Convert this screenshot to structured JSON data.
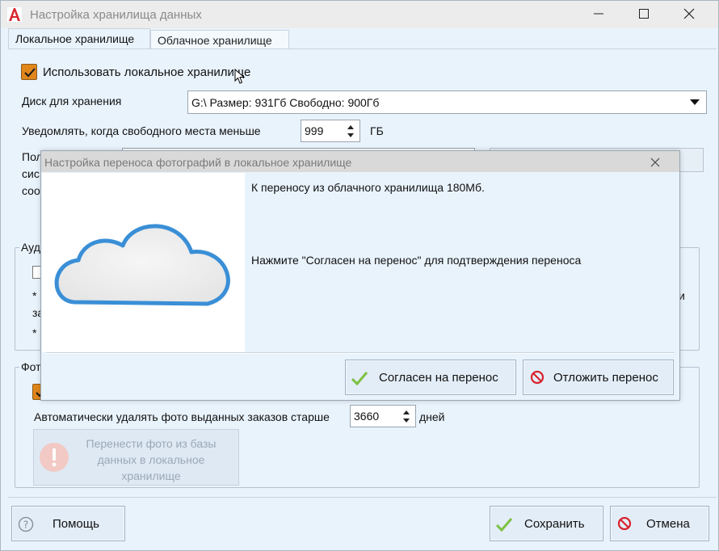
{
  "window": {
    "title": "Настройка хранилища данных"
  },
  "tabs": [
    {
      "label": "Локальное хранилище"
    },
    {
      "label": "Облачное хранилище"
    }
  ],
  "local": {
    "use_local_label": "Использовать локальное хранилище",
    "disk_label": "Диск для хранения",
    "disk_value": "G:\\ Размер: 931Гб Свободно: 900Гб",
    "notify_label": "Уведомлять, когда свободного места меньше",
    "notify_value": "999",
    "notify_unit": "ГБ",
    "partial_path_label_1": "Пол",
    "partial_path_label_2": "сис",
    "partial_path_label_3": "соо",
    "group_audio_title": "Ауд",
    "star1": "*",
    "partial_za": "за",
    "star2": "*",
    "partial_right": "и",
    "group_photo_title": "Фот",
    "auto_delete_label": "Автоматически удалять фото выданных заказов старше",
    "auto_delete_value": "3660",
    "auto_delete_unit": "дней",
    "transfer_button": "Перенести фото из базы данных в локальное хранилище"
  },
  "footer": {
    "help": "Помощь",
    "save": "Сохранить",
    "cancel": "Отмена"
  },
  "dialog": {
    "title": "Настройка переноса фотографий в локальное хранилище",
    "transfer_info": "К переносу из облачного хранилища  180Мб.",
    "instruction": "Нажмите \"Согласен на перенос\" для подтверждения переноса",
    "agree": "Согласен на перенос",
    "postpone": "Отложить перенос"
  },
  "colors": {
    "accent_orange": "#e0861a",
    "check_green": "#7dc143",
    "stop_red": "#d6232f",
    "cloud_blue": "#3a8fd6"
  }
}
